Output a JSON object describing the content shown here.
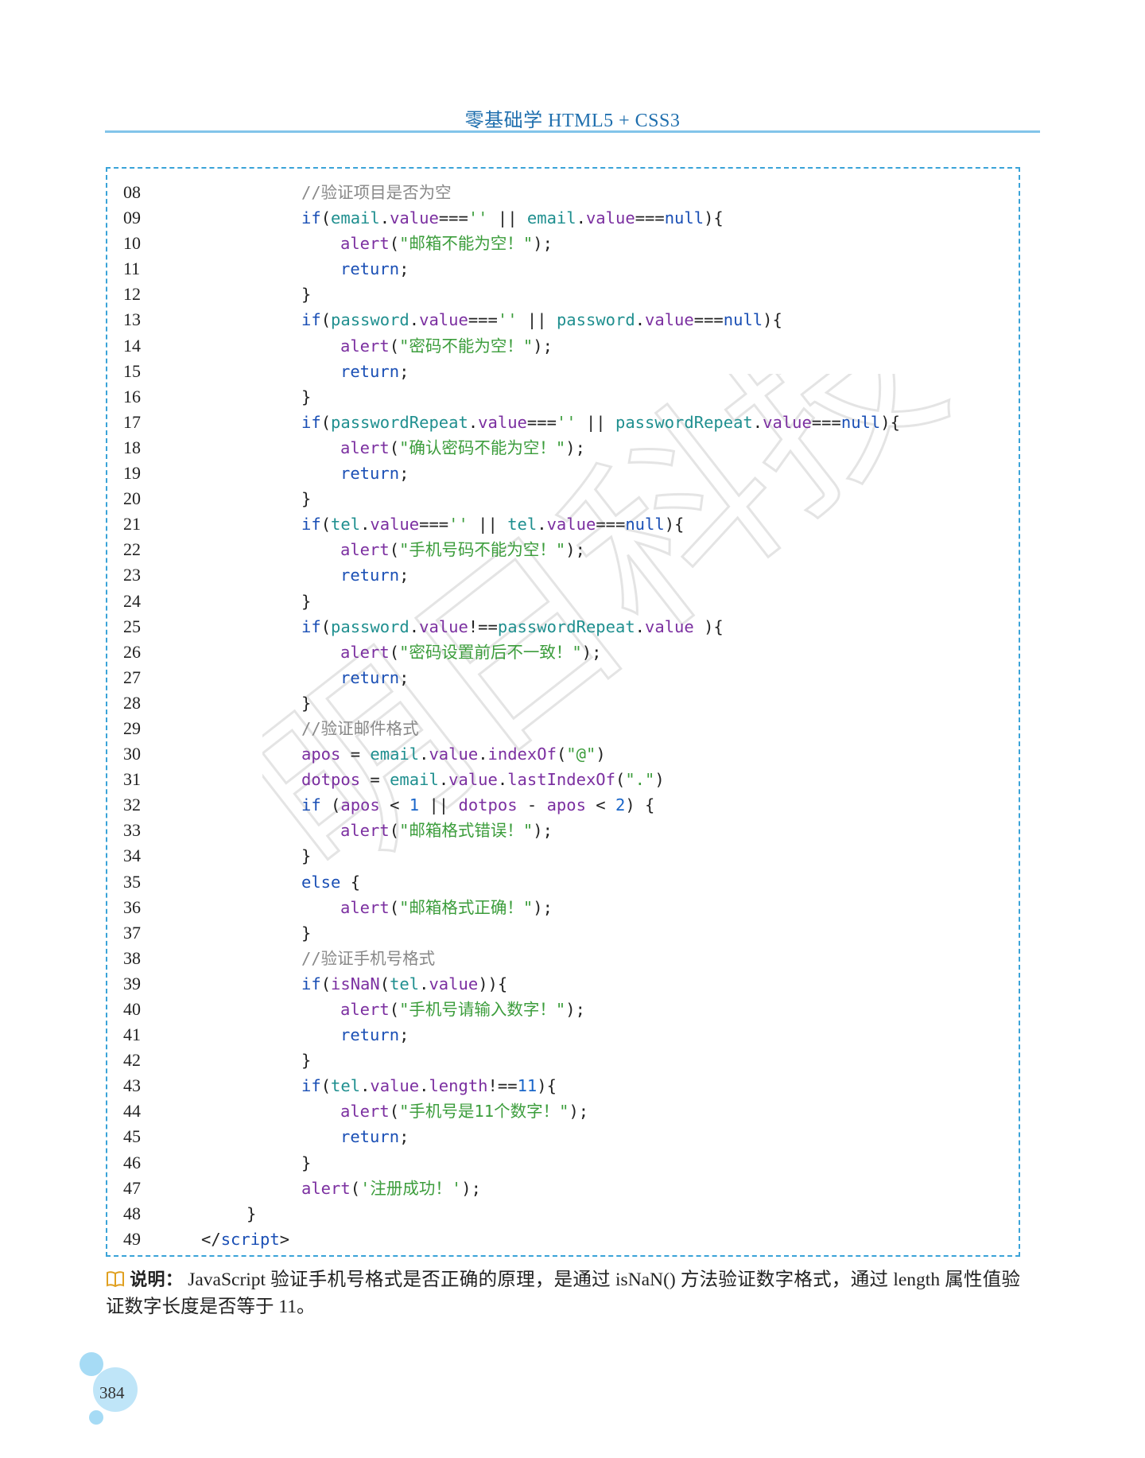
{
  "header": {
    "title": "零基础学 HTML5 + CSS3"
  },
  "code": {
    "lines": [
      {
        "num": "08",
        "indent": 2,
        "tokens": [
          [
            "cm",
            "//验证项目是否为空"
          ]
        ]
      },
      {
        "num": "09",
        "indent": 2,
        "tokens": [
          [
            "kb",
            "if"
          ],
          [
            "p",
            "("
          ],
          [
            "vr",
            "email"
          ],
          [
            "p",
            "."
          ],
          [
            "kw",
            "value"
          ],
          [
            "p",
            "==="
          ],
          [
            "st",
            "''"
          ],
          [
            "p",
            " || "
          ],
          [
            "vr",
            "email"
          ],
          [
            "p",
            "."
          ],
          [
            "kw",
            "value"
          ],
          [
            "p",
            "==="
          ],
          [
            "kb",
            "null"
          ],
          [
            "p",
            "){"
          ]
        ]
      },
      {
        "num": "10",
        "indent": 3,
        "tokens": [
          [
            "kw",
            "alert"
          ],
          [
            "p",
            "("
          ],
          [
            "st",
            "\"邮箱不能为空！\""
          ],
          [
            "p",
            ");"
          ]
        ]
      },
      {
        "num": "11",
        "indent": 3,
        "tokens": [
          [
            "kb",
            "return"
          ],
          [
            "p",
            ";"
          ]
        ]
      },
      {
        "num": "12",
        "indent": 2,
        "tokens": [
          [
            "p",
            "}"
          ]
        ]
      },
      {
        "num": "13",
        "indent": 2,
        "tokens": [
          [
            "kb",
            "if"
          ],
          [
            "p",
            "("
          ],
          [
            "vr",
            "password"
          ],
          [
            "p",
            "."
          ],
          [
            "kw",
            "value"
          ],
          [
            "p",
            "==="
          ],
          [
            "st",
            "''"
          ],
          [
            "p",
            " || "
          ],
          [
            "vr",
            "password"
          ],
          [
            "p",
            "."
          ],
          [
            "kw",
            "value"
          ],
          [
            "p",
            "==="
          ],
          [
            "kb",
            "null"
          ],
          [
            "p",
            "){"
          ]
        ]
      },
      {
        "num": "14",
        "indent": 3,
        "tokens": [
          [
            "kw",
            "alert"
          ],
          [
            "p",
            "("
          ],
          [
            "st",
            "\"密码不能为空！\""
          ],
          [
            "p",
            ");"
          ]
        ]
      },
      {
        "num": "15",
        "indent": 3,
        "tokens": [
          [
            "kb",
            "return"
          ],
          [
            "p",
            ";"
          ]
        ]
      },
      {
        "num": "16",
        "indent": 2,
        "tokens": [
          [
            "p",
            "}"
          ]
        ]
      },
      {
        "num": "17",
        "indent": 2,
        "tokens": [
          [
            "kb",
            "if"
          ],
          [
            "p",
            "("
          ],
          [
            "vr",
            "passwordRepeat"
          ],
          [
            "p",
            "."
          ],
          [
            "kw",
            "value"
          ],
          [
            "p",
            "==="
          ],
          [
            "st",
            "''"
          ],
          [
            "p",
            " || "
          ],
          [
            "vr",
            "passwordRepeat"
          ],
          [
            "p",
            "."
          ],
          [
            "kw",
            "value"
          ],
          [
            "p",
            "==="
          ],
          [
            "kb",
            "null"
          ],
          [
            "p",
            "){"
          ]
        ]
      },
      {
        "num": "18",
        "indent": 3,
        "tokens": [
          [
            "kw",
            "alert"
          ],
          [
            "p",
            "("
          ],
          [
            "st",
            "\"确认密码不能为空！\""
          ],
          [
            "p",
            ");"
          ]
        ]
      },
      {
        "num": "19",
        "indent": 3,
        "tokens": [
          [
            "kb",
            "return"
          ],
          [
            "p",
            ";"
          ]
        ]
      },
      {
        "num": "20",
        "indent": 2,
        "tokens": [
          [
            "p",
            "}"
          ]
        ]
      },
      {
        "num": "21",
        "indent": 2,
        "tokens": [
          [
            "kb",
            "if"
          ],
          [
            "p",
            "("
          ],
          [
            "vr",
            "tel"
          ],
          [
            "p",
            "."
          ],
          [
            "kw",
            "value"
          ],
          [
            "p",
            "==="
          ],
          [
            "st",
            "''"
          ],
          [
            "p",
            " || "
          ],
          [
            "vr",
            "tel"
          ],
          [
            "p",
            "."
          ],
          [
            "kw",
            "value"
          ],
          [
            "p",
            "==="
          ],
          [
            "kb",
            "null"
          ],
          [
            "p",
            "){"
          ]
        ]
      },
      {
        "num": "22",
        "indent": 3,
        "tokens": [
          [
            "kw",
            "alert"
          ],
          [
            "p",
            "("
          ],
          [
            "st",
            "\"手机号码不能为空！\""
          ],
          [
            "p",
            ");"
          ]
        ]
      },
      {
        "num": "23",
        "indent": 3,
        "tokens": [
          [
            "kb",
            "return"
          ],
          [
            "p",
            ";"
          ]
        ]
      },
      {
        "num": "24",
        "indent": 2,
        "tokens": [
          [
            "p",
            "}"
          ]
        ]
      },
      {
        "num": "25",
        "indent": 2,
        "tokens": [
          [
            "kb",
            "if"
          ],
          [
            "p",
            "("
          ],
          [
            "vr",
            "password"
          ],
          [
            "p",
            "."
          ],
          [
            "kw",
            "value"
          ],
          [
            "p",
            "!=="
          ],
          [
            "vr",
            "passwordRepeat"
          ],
          [
            "p",
            "."
          ],
          [
            "kw",
            "value"
          ],
          [
            "p",
            " ){"
          ]
        ]
      },
      {
        "num": "26",
        "indent": 3,
        "tokens": [
          [
            "kw",
            "alert"
          ],
          [
            "p",
            "("
          ],
          [
            "st",
            "\"密码设置前后不一致！\""
          ],
          [
            "p",
            ");"
          ]
        ]
      },
      {
        "num": "27",
        "indent": 3,
        "tokens": [
          [
            "kb",
            "return"
          ],
          [
            "p",
            ";"
          ]
        ]
      },
      {
        "num": "28",
        "indent": 2,
        "tokens": [
          [
            "p",
            "}"
          ]
        ]
      },
      {
        "num": "29",
        "indent": 2,
        "tokens": [
          [
            "cm",
            "//验证邮件格式"
          ]
        ]
      },
      {
        "num": "30",
        "indent": 2,
        "tokens": [
          [
            "kw",
            "apos"
          ],
          [
            "p",
            " = "
          ],
          [
            "vr",
            "email"
          ],
          [
            "p",
            "."
          ],
          [
            "kw",
            "value"
          ],
          [
            "p",
            "."
          ],
          [
            "kw",
            "indexOf"
          ],
          [
            "p",
            "("
          ],
          [
            "st",
            "\"@\""
          ],
          [
            "p",
            ")"
          ]
        ]
      },
      {
        "num": "31",
        "indent": 2,
        "tokens": [
          [
            "kw",
            "dotpos"
          ],
          [
            "p",
            " = "
          ],
          [
            "vr",
            "email"
          ],
          [
            "p",
            "."
          ],
          [
            "kw",
            "value"
          ],
          [
            "p",
            "."
          ],
          [
            "kw",
            "lastIndexOf"
          ],
          [
            "p",
            "("
          ],
          [
            "st",
            "\".\""
          ],
          [
            "p",
            ")"
          ]
        ]
      },
      {
        "num": "32",
        "indent": 2,
        "tokens": [
          [
            "kb",
            "if"
          ],
          [
            "p",
            " ("
          ],
          [
            "kw",
            "apos"
          ],
          [
            "p",
            " < "
          ],
          [
            "nm",
            "1"
          ],
          [
            "p",
            " || "
          ],
          [
            "kw",
            "dotpos"
          ],
          [
            "p",
            " - "
          ],
          [
            "kw",
            "apos"
          ],
          [
            "p",
            " < "
          ],
          [
            "nm",
            "2"
          ],
          [
            "p",
            ") {"
          ]
        ]
      },
      {
        "num": "33",
        "indent": 3,
        "tokens": [
          [
            "kw",
            "alert"
          ],
          [
            "p",
            "("
          ],
          [
            "st",
            "\"邮箱格式错误！\""
          ],
          [
            "p",
            ");"
          ]
        ]
      },
      {
        "num": "34",
        "indent": 2,
        "tokens": [
          [
            "p",
            "}"
          ]
        ]
      },
      {
        "num": "35",
        "indent": 2,
        "tokens": [
          [
            "kb",
            "else"
          ],
          [
            "p",
            " {"
          ]
        ]
      },
      {
        "num": "36",
        "indent": 3,
        "tokens": [
          [
            "kw",
            "alert"
          ],
          [
            "p",
            "("
          ],
          [
            "st",
            "\"邮箱格式正确！\""
          ],
          [
            "p",
            ");"
          ]
        ]
      },
      {
        "num": "37",
        "indent": 2,
        "tokens": [
          [
            "p",
            "}"
          ]
        ]
      },
      {
        "num": "38",
        "indent": 2,
        "tokens": [
          [
            "cm",
            "//验证手机号格式"
          ]
        ]
      },
      {
        "num": "39",
        "indent": 2,
        "tokens": [
          [
            "kb",
            "if"
          ],
          [
            "p",
            "("
          ],
          [
            "kw",
            "isNaN"
          ],
          [
            "p",
            "("
          ],
          [
            "vr",
            "tel"
          ],
          [
            "p",
            "."
          ],
          [
            "kw",
            "value"
          ],
          [
            "p",
            ")){"
          ]
        ]
      },
      {
        "num": "40",
        "indent": 3,
        "tokens": [
          [
            "kw",
            "alert"
          ],
          [
            "p",
            "("
          ],
          [
            "st",
            "\"手机号请输入数字！\""
          ],
          [
            "p",
            ");"
          ]
        ]
      },
      {
        "num": "41",
        "indent": 3,
        "tokens": [
          [
            "kb",
            "return"
          ],
          [
            "p",
            ";"
          ]
        ]
      },
      {
        "num": "42",
        "indent": 2,
        "tokens": [
          [
            "p",
            "}"
          ]
        ]
      },
      {
        "num": "43",
        "indent": 2,
        "tokens": [
          [
            "kb",
            "if"
          ],
          [
            "p",
            "("
          ],
          [
            "vr",
            "tel"
          ],
          [
            "p",
            "."
          ],
          [
            "kw",
            "value"
          ],
          [
            "p",
            "."
          ],
          [
            "kw",
            "length"
          ],
          [
            "p",
            "!=="
          ],
          [
            "nm",
            "11"
          ],
          [
            "p",
            "){"
          ]
        ]
      },
      {
        "num": "44",
        "indent": 3,
        "tokens": [
          [
            "kw",
            "alert"
          ],
          [
            "p",
            "("
          ],
          [
            "st",
            "\"手机号是11个数字！\""
          ],
          [
            "p",
            ");"
          ]
        ]
      },
      {
        "num": "45",
        "indent": 3,
        "tokens": [
          [
            "kb",
            "return"
          ],
          [
            "p",
            ";"
          ]
        ]
      },
      {
        "num": "46",
        "indent": 2,
        "tokens": [
          [
            "p",
            "}"
          ]
        ]
      },
      {
        "num": "47",
        "indent": 2,
        "tokens": [
          [
            "kw",
            "alert"
          ],
          [
            "p",
            "("
          ],
          [
            "st",
            "'注册成功！'"
          ],
          [
            "p",
            ");"
          ]
        ]
      },
      {
        "num": "48",
        "indent": 1,
        "tokens": [
          [
            "p",
            "}"
          ]
        ]
      },
      {
        "num": "49",
        "indent": 0,
        "tokens": [
          [
            "p",
            "</"
          ],
          [
            "kb",
            "script"
          ],
          [
            "p",
            ">"
          ]
        ]
      }
    ]
  },
  "note": {
    "label": "说明：",
    "text": "JavaScript 验证手机号格式是否正确的原理，是通过 isNaN() 方法验证数字格式，通过 length 属性值验证数字长度是否等于 11。",
    "icon": "book-icon"
  },
  "watermark": {
    "text": "明日科技"
  },
  "footer": {
    "page_number": "384"
  },
  "colors": {
    "accent": "#3aa3d8",
    "header_text": "#1f6fae",
    "rule": "#82c4ea",
    "keyword": "#1a4fb5",
    "property": "#7b2fa0",
    "variable": "#1f8f8f",
    "string": "#3c9d3c",
    "comment": "#888888"
  }
}
